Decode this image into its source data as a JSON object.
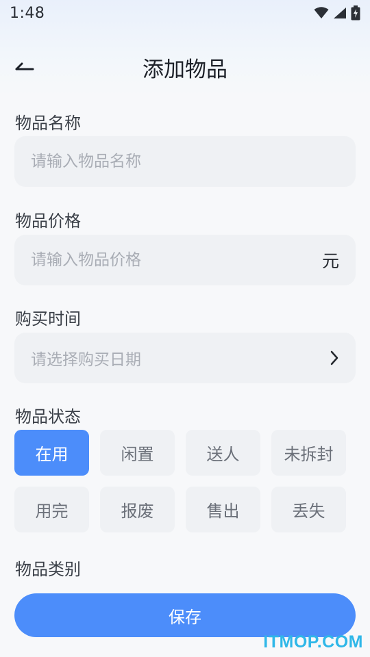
{
  "status_bar": {
    "time": "1:48",
    "icons": [
      "wifi-icon",
      "signal-icon",
      "battery-charging-icon"
    ]
  },
  "header": {
    "title": "添加物品",
    "back_icon": "back-arrow-icon"
  },
  "form": {
    "name": {
      "label": "物品名称",
      "placeholder": "请输入物品名称"
    },
    "price": {
      "label": "物品价格",
      "placeholder": "请输入物品价格",
      "unit": "元"
    },
    "purchase_date": {
      "label": "购买时间",
      "placeholder": "请选择购买日期",
      "icon": "chevron-right-icon"
    },
    "status": {
      "label": "物品状态",
      "options": [
        "在用",
        "闲置",
        "送人",
        "未拆封",
        "用完",
        "报废",
        "售出",
        "丢失"
      ],
      "selected": "在用"
    },
    "category": {
      "label": "物品类别"
    }
  },
  "save_button": {
    "label": "保存"
  },
  "watermark": "ITMOP.COM",
  "colors": {
    "accent": "#4c8dfa",
    "field_bg": "#eff1f4",
    "page_bg": "#f7f8fa"
  }
}
